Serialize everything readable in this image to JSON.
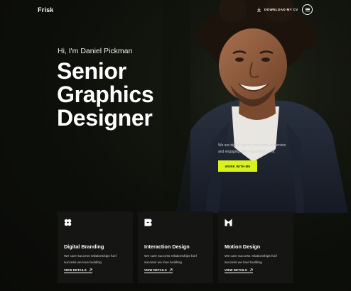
{
  "header": {
    "logo": "Frisk",
    "download_label": "DOWNLOAD MY CV"
  },
  "hero": {
    "greeting": "Hi, I'm Daniel Pickman",
    "title_lines": [
      "Senior",
      "Graphics",
      "Designer"
    ],
    "description": "We are digital agency that helps immersive and engaging user experiences that",
    "cta_label": "WORK WITH ME"
  },
  "cards": [
    {
      "icon": "flower-icon",
      "title": "Digital Branding",
      "text": "We care success relationships fuel success we love building",
      "link": "VIEW DETAILS"
    },
    {
      "icon": "b-shape-icon",
      "title": "Interaction Design",
      "text": "We care success relationships fuel success we love building",
      "link": "VIEW DETAILS"
    },
    {
      "icon": "m-shape-icon",
      "title": "Motion Design",
      "text": "We care success relationships fuel success we love building",
      "link": "VIEW DETAILS"
    }
  ],
  "colors": {
    "background": "#0c0e09",
    "accent": "#d8f21e",
    "card": "#151614"
  }
}
